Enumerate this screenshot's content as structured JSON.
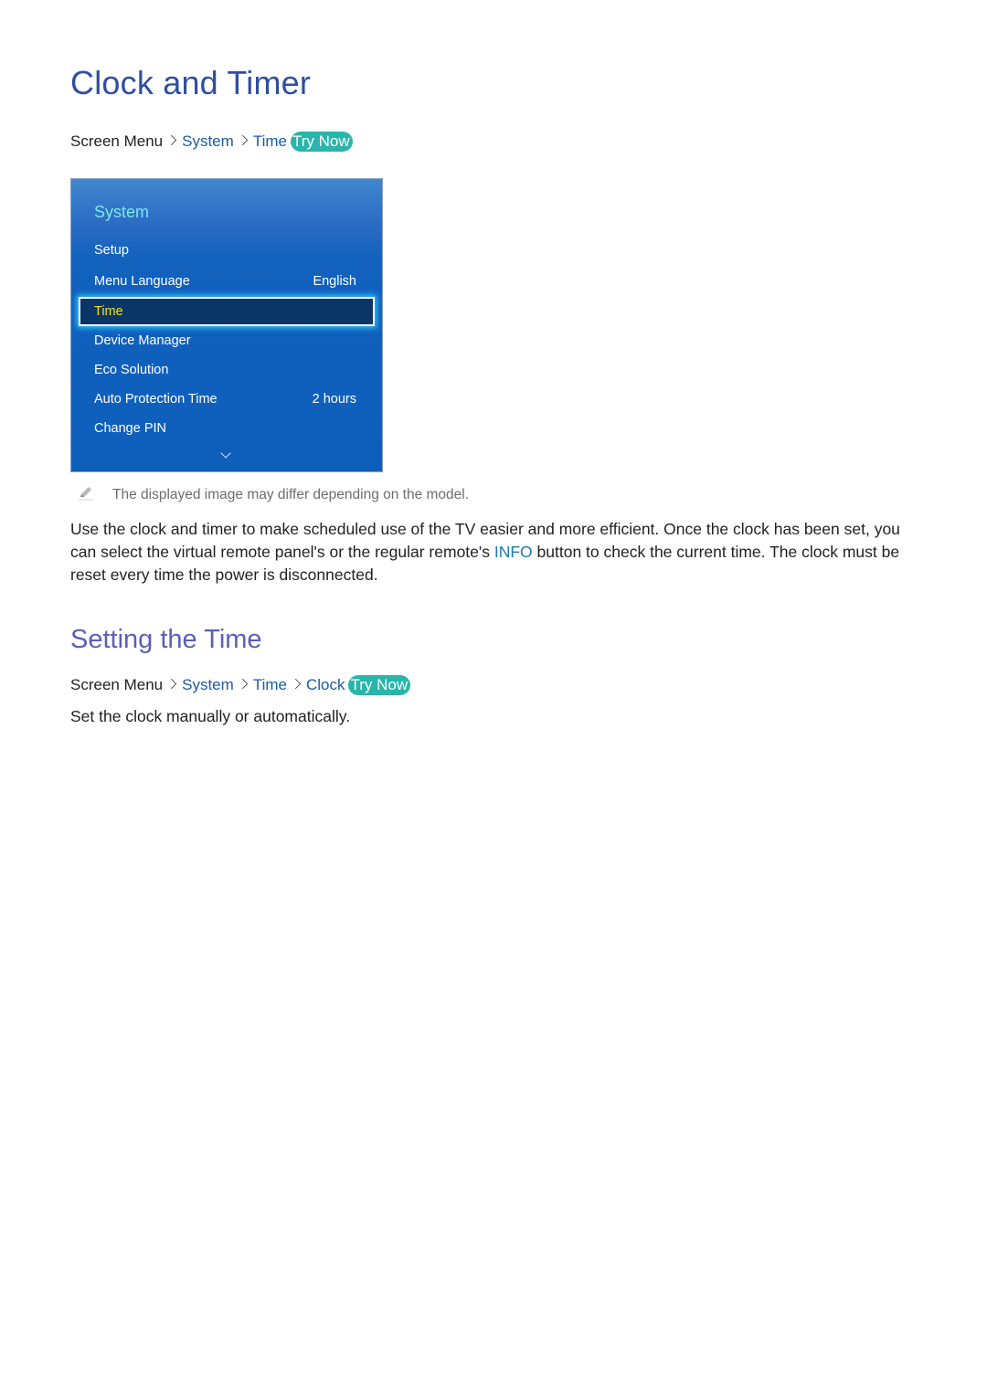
{
  "section1": {
    "title": "Clock and Timer",
    "breadcrumb": {
      "root": "Screen Menu",
      "items": [
        "System",
        "Time"
      ],
      "try_now": "Try Now"
    },
    "menu_image": {
      "title": "System",
      "items": [
        {
          "label": "Setup",
          "value": ""
        },
        {
          "label": "Menu Language",
          "value": "English"
        },
        {
          "label": "Time",
          "value": "",
          "selected": true
        },
        {
          "label": "Device Manager",
          "value": ""
        },
        {
          "label": "Eco Solution",
          "value": ""
        },
        {
          "label": "Auto Protection Time",
          "value": "2 hours"
        },
        {
          "label": "Change PIN",
          "value": ""
        }
      ],
      "more_icon": "chevron-down-icon"
    },
    "note": {
      "icon": "pencil-icon",
      "text": "The displayed image may differ depending on the model."
    },
    "body": {
      "part1": "Use the clock and timer to make scheduled use of the TV easier and more efficient. Once the clock has been set, you can select the virtual remote panel's or the regular remote's ",
      "keyword": "INFO",
      "part2": " button to check the current time. The clock must be reset every time the power is disconnected."
    }
  },
  "section2": {
    "title": "Setting the Time",
    "breadcrumb": {
      "root": "Screen Menu",
      "items": [
        "System",
        "Time",
        "Clock"
      ],
      "try_now": "Try Now"
    },
    "body": "Set the clock manually or automatically."
  },
  "colors": {
    "title": "#2e4fa1",
    "subtitle": "#5b5fb8",
    "link": "#1a5ba5",
    "try_now_bg": "#2ab5ac",
    "keyword": "#1b7ab7",
    "menu_bg": "#0d5fbb",
    "menu_title": "#7fe6e8",
    "selected_text": "#f2e200"
  }
}
